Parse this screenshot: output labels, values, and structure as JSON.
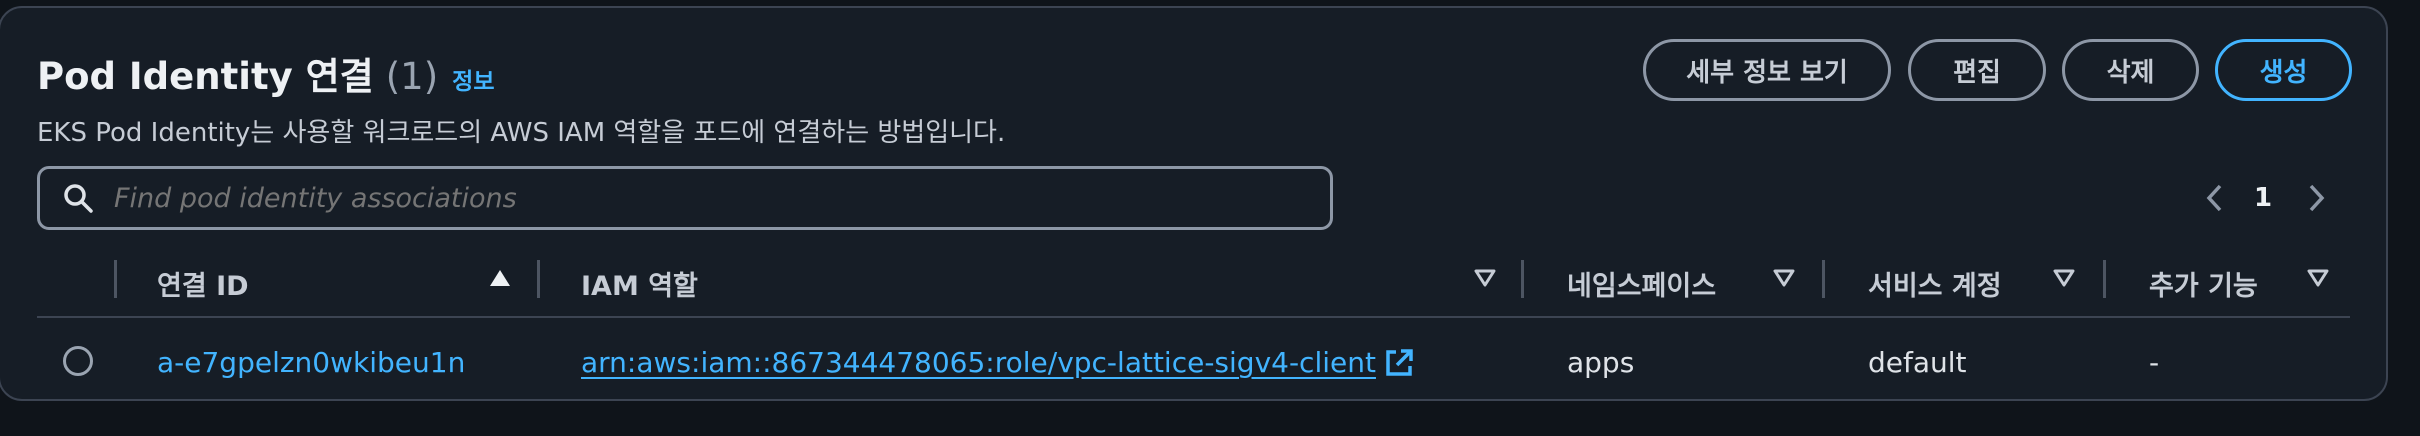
{
  "header": {
    "title": "Pod Identity 연결",
    "count": "(1)",
    "info_link": "정보",
    "description": "EKS Pod Identity는 사용할 워크로드의 AWS IAM 역할을 포드에 연결하는 방법입니다."
  },
  "actions": {
    "view_details": "세부 정보 보기",
    "edit": "편집",
    "delete": "삭제",
    "create": "생성"
  },
  "search": {
    "placeholder": "Find pod identity associations"
  },
  "pagination": {
    "current_page": "1"
  },
  "table": {
    "columns": [
      "연결 ID",
      "IAM 역할",
      "네임스페이스",
      "서비스 계정",
      "추가 기능"
    ],
    "rows": [
      {
        "association_id": "a-e7gpelzn0wkibeu1n",
        "iam_role": "arn:aws:iam::867344478065:role/vpc-lattice-sigv4-client",
        "namespace": "apps",
        "service_account": "default",
        "addon": "-"
      }
    ]
  },
  "colors": {
    "accent": "#42b4ff",
    "panel_background": "#161d26",
    "page_background": "#0f141a",
    "border": "#3c4452"
  }
}
